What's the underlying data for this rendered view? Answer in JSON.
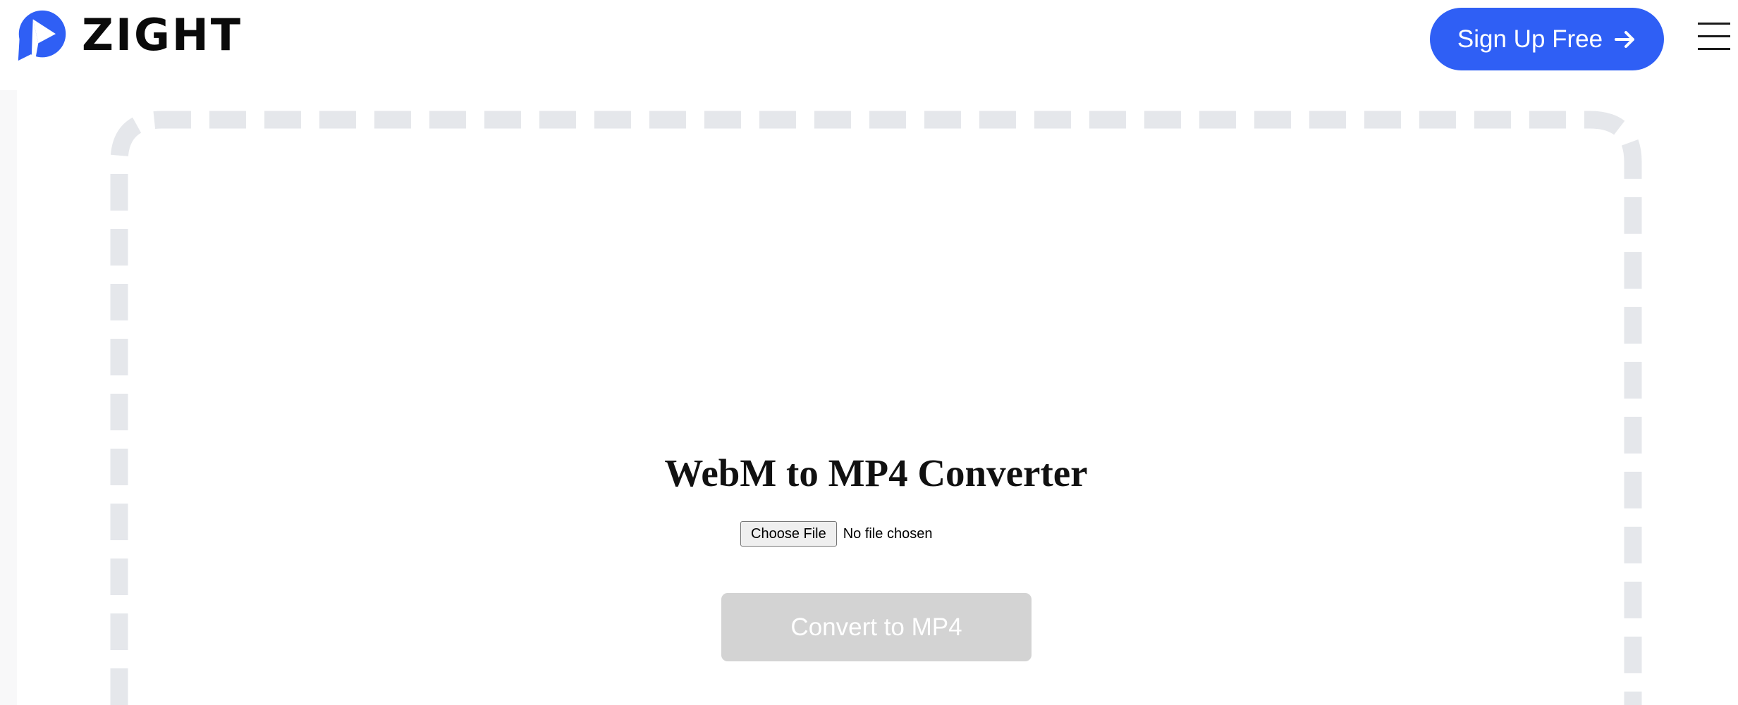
{
  "header": {
    "logo_text": "ZIGHT",
    "signup_label": "Sign Up Free",
    "menu_icon": "hamburger-icon",
    "colors": {
      "brand_blue": "#2f5ff5"
    }
  },
  "converter": {
    "title": "WebM to MP4 Converter",
    "choose_file_label": "Choose File",
    "file_status": "No file chosen",
    "convert_label": "Convert to MP4",
    "convert_disabled": true,
    "colors": {
      "dropzone_dash": "#e5e7eb",
      "convert_disabled_bg": "#d3d3d3"
    }
  }
}
